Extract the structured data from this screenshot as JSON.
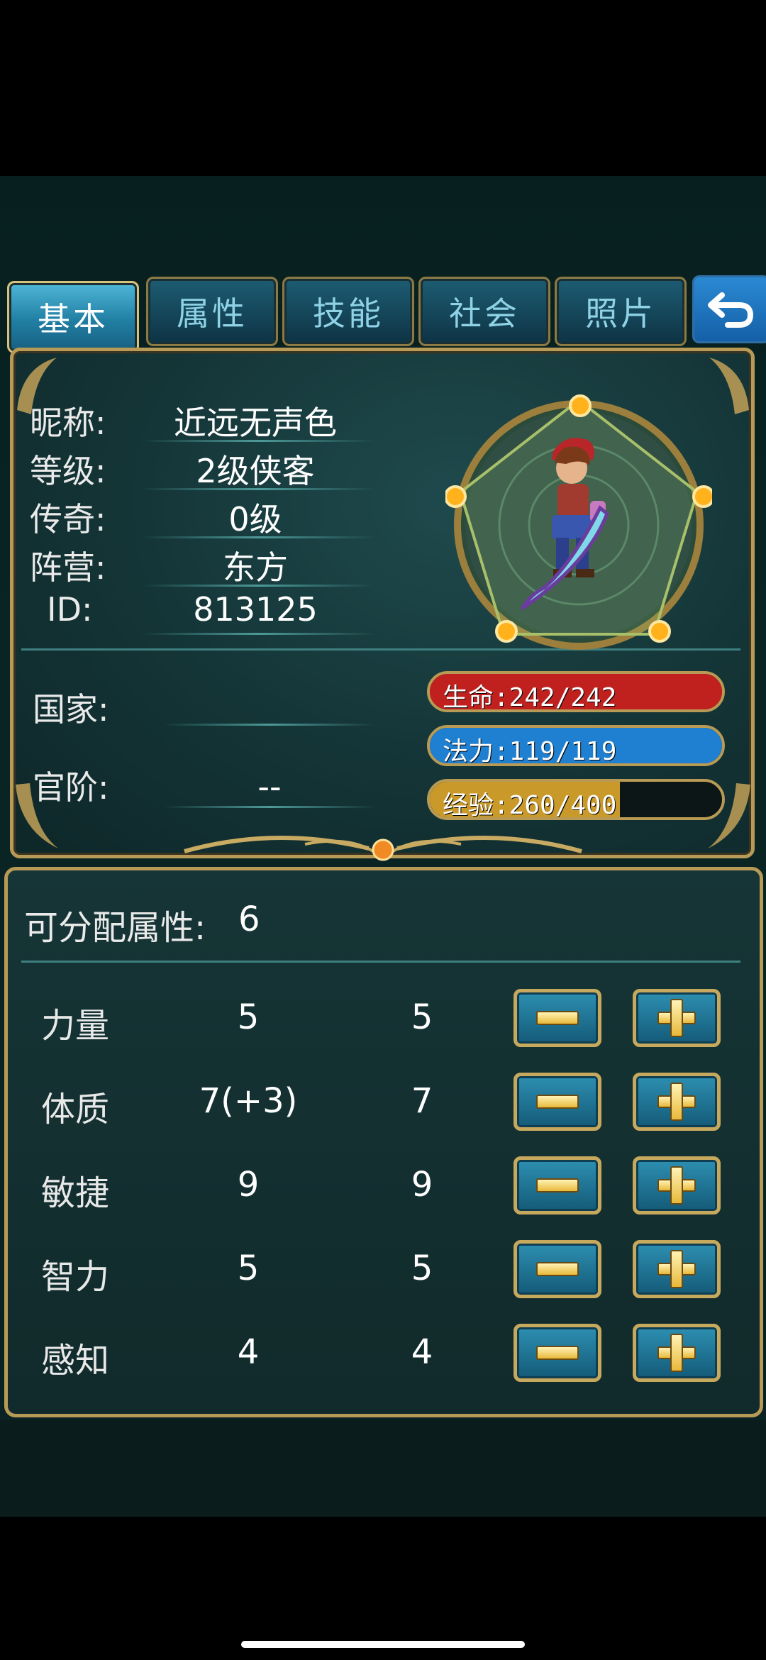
{
  "tabs": [
    {
      "label": "基本",
      "active": true
    },
    {
      "label": "属性",
      "active": false
    },
    {
      "label": "技能",
      "active": false
    },
    {
      "label": "社会",
      "active": false
    },
    {
      "label": "照片",
      "active": false
    }
  ],
  "info": {
    "nickname_label": "昵称:",
    "nickname": "近远无声色",
    "level_label": "等级:",
    "level": "2级侠客",
    "legend_label": "传奇:",
    "legend": "0级",
    "camp_label": "阵营:",
    "camp": "东方",
    "id_label": "ID:",
    "id": "813125",
    "country_label": "国家:",
    "country": "",
    "rank_label": "官阶:",
    "rank": "--"
  },
  "bars": {
    "hp": {
      "text": "生命:242/242",
      "current": 242,
      "max": 242,
      "color": "#c0211e"
    },
    "mp": {
      "text": "法力:119/119",
      "current": 119,
      "max": 119,
      "color": "#1f7fd0"
    },
    "exp": {
      "text": "经验:260/400",
      "current": 260,
      "max": 400,
      "color": "#c99a2a"
    }
  },
  "attributes": {
    "allocatable_label": "可分配属性:",
    "allocatable_value": "6",
    "rows": [
      {
        "name": "力量",
        "base": "5",
        "current": "5"
      },
      {
        "name": "体质",
        "base": "7(+3)",
        "current": "7"
      },
      {
        "name": "敏捷",
        "base": "9",
        "current": "9"
      },
      {
        "name": "智力",
        "base": "5",
        "current": "5"
      },
      {
        "name": "感知",
        "base": "4",
        "current": "4"
      }
    ]
  },
  "icons": {
    "back": "back-arrow-icon",
    "minus": "minus-icon",
    "plus": "plus-icon"
  }
}
